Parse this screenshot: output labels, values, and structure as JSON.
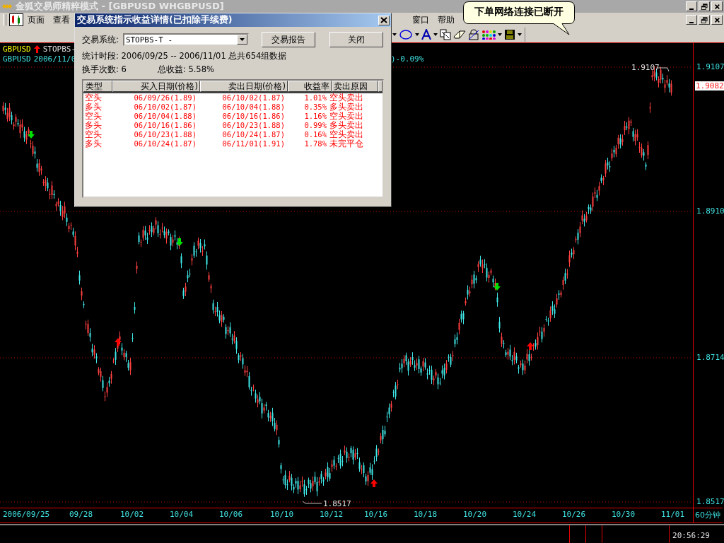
{
  "window": {
    "title": "金狐交易师精粹模式 - [GBPUSD WHGBPUSD]"
  },
  "menu": [
    {
      "label": "页面"
    },
    {
      "label": "查看"
    },
    {
      "label": "窗口"
    },
    {
      "label": "帮助"
    }
  ],
  "balloon": {
    "text": "下单网络连接已断开"
  },
  "chart": {
    "legend": [
      {
        "symbol": "GBPUSD",
        "text": "STOPBS-"
      },
      {
        "symbol": "GBPUSD",
        "text": "2006/11/0"
      }
    ],
    "legend_tail": ")-0.09%",
    "high_label": "1.9107",
    "low_label": "1.8517",
    "price_ticks": [
      "1.9107",
      "1.8910",
      "1.8714",
      "1.8517"
    ],
    "last_price": "1.9082",
    "x_ticks": [
      "2006/09/25",
      "09/28",
      "10/02",
      "10/04",
      "10/06",
      "10/10",
      "10/12",
      "10/16",
      "10/18",
      "10/20",
      "10/24",
      "10/26",
      "10/30",
      "11/01"
    ],
    "period": "60分钟"
  },
  "dialog": {
    "title": "交易系统指示收益详情(已扣除手续费)",
    "system_label": "交易系统:",
    "system_value": "STOPBS-T -",
    "buttons": [
      "交易报告",
      "关闭"
    ],
    "period_text": "统计时段: 2006/09/25 -- 2006/11/01 总共654组数据",
    "trades_label": "换手次数: 6",
    "total_label": "总收益: 5.58%",
    "columns": [
      "类型",
      "买入日期(价格)",
      "卖出日期(价格)",
      "收益率",
      "卖出原因"
    ],
    "rows": [
      [
        "空头",
        "06/09/26(1.89)",
        "06/10/02(1.87)",
        "1.01%",
        "空头卖出"
      ],
      [
        "多头",
        "06/10/02(1.87)",
        "06/10/04(1.88)",
        "0.35%",
        "多头卖出"
      ],
      [
        "空头",
        "06/10/04(1.88)",
        "06/10/16(1.86)",
        "1.16%",
        "空头卖出"
      ],
      [
        "多头",
        "06/10/16(1.86)",
        "06/10/23(1.88)",
        "0.99%",
        "多头卖出"
      ],
      [
        "空头",
        "06/10/23(1.88)",
        "06/10/24(1.87)",
        "0.16%",
        "空头卖出"
      ],
      [
        "多头",
        "06/10/24(1.87)",
        "06/11/01(1.91)",
        "1.78%",
        "未完平仓"
      ]
    ]
  },
  "status_bar": {
    "time": "20:56:29"
  }
}
